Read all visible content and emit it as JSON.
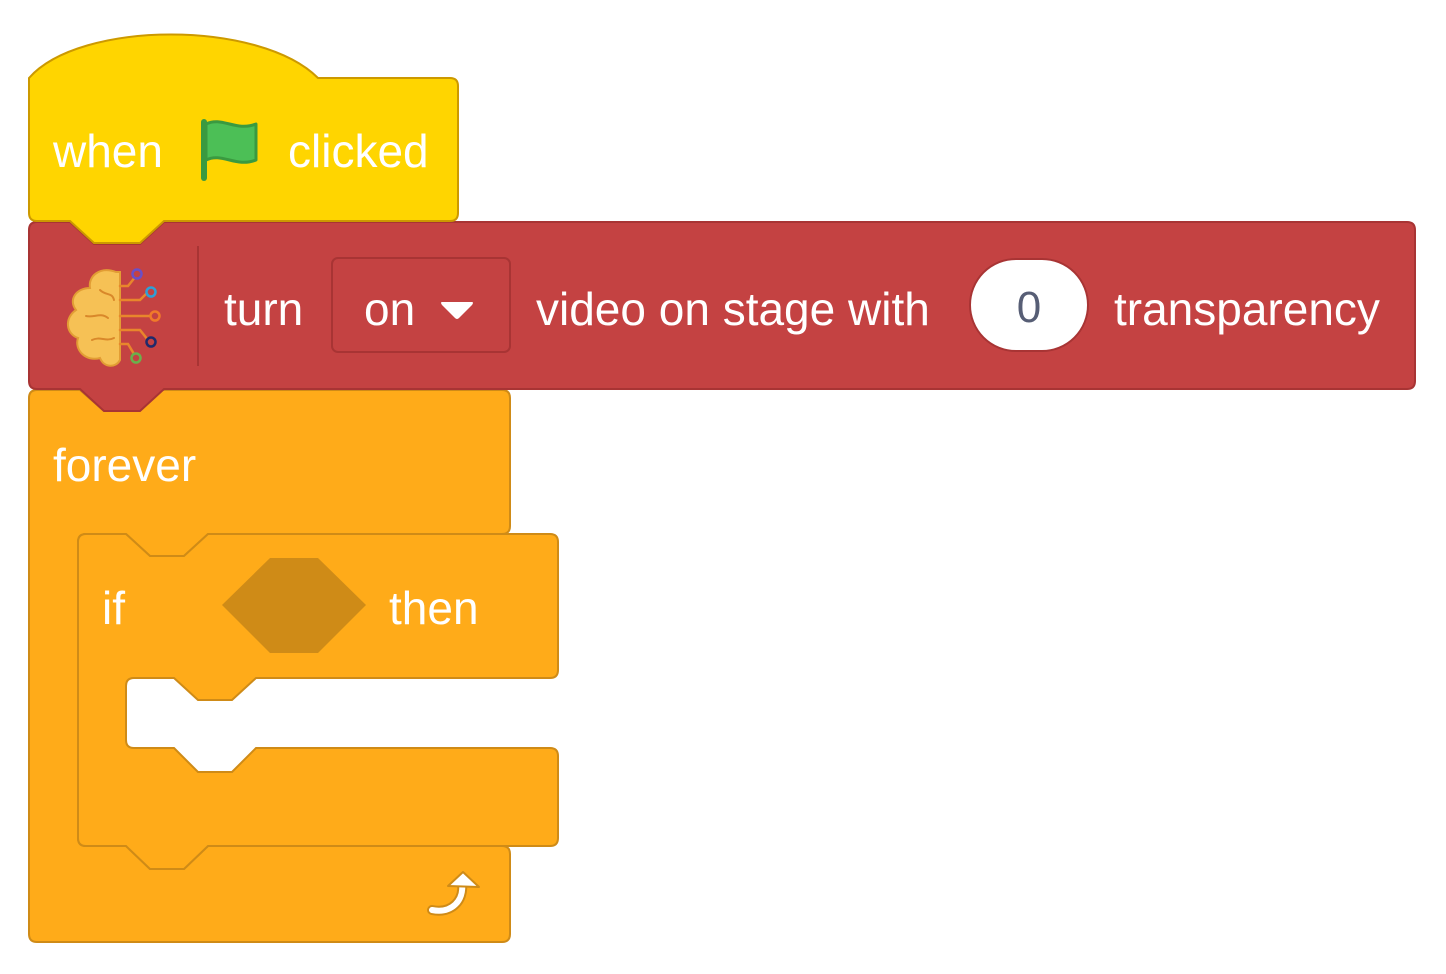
{
  "colors": {
    "event": "#ffd500",
    "event_border": "#cc9900",
    "ml_block": "#c44242",
    "ml_border": "#a83434",
    "control": "#ffab19",
    "control_border": "#cf8b17",
    "empty_boolean": "#cf8b17",
    "number_field_text": "#575e75",
    "flag": "#4cbf56"
  },
  "hat_block": {
    "word_before": "when",
    "icon": "green-flag-icon",
    "word_after": "clicked"
  },
  "video_block": {
    "icon": "ai-brain-icon",
    "word_turn": "turn",
    "dropdown_value": "on",
    "dropdown_icon": "caret-down-icon",
    "middle_text": "video on stage with",
    "transparency_value": "0",
    "word_end": "transparency"
  },
  "forever_block": {
    "label": "forever",
    "icon": "loop-arrow-icon"
  },
  "if_block": {
    "word_if": "if",
    "word_then": "then"
  }
}
